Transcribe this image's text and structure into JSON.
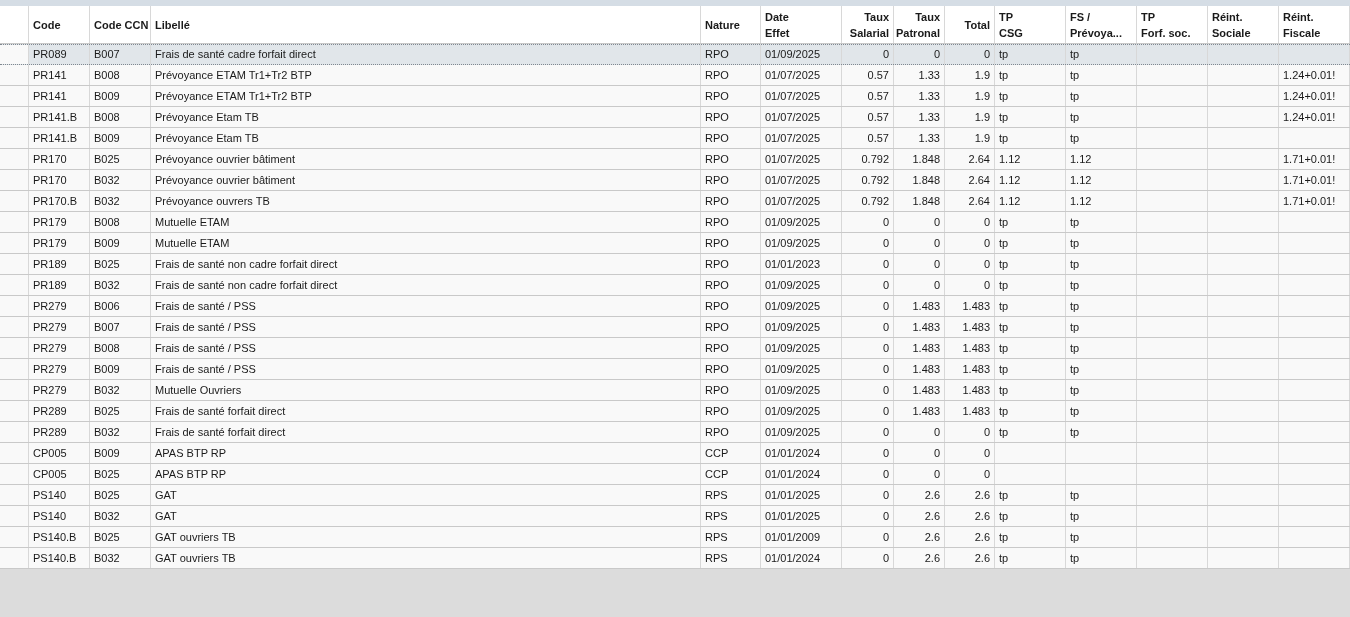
{
  "table": {
    "columns": [
      {
        "lines": [
          "Code"
        ],
        "kind": "text"
      },
      {
        "lines": [
          "Code CCN"
        ],
        "kind": "text"
      },
      {
        "lines": [
          "Libellé"
        ],
        "kind": "text"
      },
      {
        "lines": [
          "Nature"
        ],
        "kind": "text"
      },
      {
        "lines": [
          "Date",
          "Effet"
        ],
        "kind": "text"
      },
      {
        "lines": [
          "Taux",
          "Salarial"
        ],
        "kind": "number"
      },
      {
        "lines": [
          "Taux",
          "Patronal"
        ],
        "kind": "number"
      },
      {
        "lines": [
          "Total"
        ],
        "kind": "number"
      },
      {
        "lines": [
          "TP",
          "CSG"
        ],
        "kind": "text"
      },
      {
        "lines": [
          "FS /",
          "Prévoya..."
        ],
        "kind": "text"
      },
      {
        "lines": [
          "TP",
          "Forf. soc."
        ],
        "kind": "text"
      },
      {
        "lines": [
          "Réint.",
          "Sociale"
        ],
        "kind": "text"
      },
      {
        "lines": [
          "Réint.",
          "Fiscale"
        ],
        "kind": "text"
      }
    ],
    "rows": [
      {
        "selected": true,
        "cells": [
          "PR089",
          "B007",
          "Frais de santé cadre forfait direct",
          "RPO",
          "01/09/2025",
          "0",
          "0",
          "0",
          "tp",
          "tp",
          null,
          null,
          null
        ]
      },
      {
        "selected": false,
        "cells": [
          "PR141",
          "B008",
          "Prévoyance ETAM Tr1+Tr2 BTP",
          "RPO",
          "01/07/2025",
          "0.57",
          "1.33",
          "1.9",
          "tp",
          "tp",
          null,
          null,
          "1.24+0.01!"
        ]
      },
      {
        "selected": false,
        "cells": [
          "PR141",
          "B009",
          "Prévoyance ETAM Tr1+Tr2 BTP",
          "RPO",
          "01/07/2025",
          "0.57",
          "1.33",
          "1.9",
          "tp",
          "tp",
          null,
          null,
          "1.24+0.01!"
        ]
      },
      {
        "selected": false,
        "cells": [
          "PR141.B",
          "B008",
          "Prévoyance Etam TB",
          "RPO",
          "01/07/2025",
          "0.57",
          "1.33",
          "1.9",
          "tp",
          "tp",
          null,
          null,
          "1.24+0.01!"
        ]
      },
      {
        "selected": false,
        "cells": [
          "PR141.B",
          "B009",
          "Prévoyance Etam TB",
          "RPO",
          "01/07/2025",
          "0.57",
          "1.33",
          "1.9",
          "tp",
          "tp",
          null,
          null,
          null
        ]
      },
      {
        "selected": false,
        "cells": [
          "PR170",
          "B025",
          "Prévoyance ouvrier bâtiment",
          "RPO",
          "01/07/2025",
          "0.792",
          "1.848",
          "2.64",
          "1.12",
          "1.12",
          null,
          null,
          "1.71+0.01!"
        ]
      },
      {
        "selected": false,
        "cells": [
          "PR170",
          "B032",
          "Prévoyance ouvrier bâtiment",
          "RPO",
          "01/07/2025",
          "0.792",
          "1.848",
          "2.64",
          "1.12",
          "1.12",
          null,
          null,
          "1.71+0.01!"
        ]
      },
      {
        "selected": false,
        "cells": [
          "PR170.B",
          "B032",
          "Prévoyance ouvrers TB",
          "RPO",
          "01/07/2025",
          "0.792",
          "1.848",
          "2.64",
          "1.12",
          "1.12",
          null,
          null,
          "1.71+0.01!"
        ]
      },
      {
        "selected": false,
        "cells": [
          "PR179",
          "B008",
          "Mutuelle ETAM",
          "RPO",
          "01/09/2025",
          "0",
          "0",
          "0",
          "tp",
          "tp",
          null,
          null,
          null
        ]
      },
      {
        "selected": false,
        "cells": [
          "PR179",
          "B009",
          "Mutuelle ETAM",
          "RPO",
          "01/09/2025",
          "0",
          "0",
          "0",
          "tp",
          "tp",
          null,
          null,
          null
        ]
      },
      {
        "selected": false,
        "cells": [
          "PR189",
          "B025",
          "Frais de santé non cadre forfait direct",
          "RPO",
          "01/01/2023",
          "0",
          "0",
          "0",
          "tp",
          "tp",
          null,
          null,
          null
        ]
      },
      {
        "selected": false,
        "cells": [
          "PR189",
          "B032",
          "Frais de santé non cadre forfait direct",
          "RPO",
          "01/09/2025",
          "0",
          "0",
          "0",
          "tp",
          "tp",
          null,
          null,
          null
        ]
      },
      {
        "selected": false,
        "cells": [
          "PR279",
          "B006",
          "Frais de santé / PSS",
          "RPO",
          "01/09/2025",
          "0",
          "1.483",
          "1.483",
          "tp",
          "tp",
          null,
          null,
          null
        ]
      },
      {
        "selected": false,
        "cells": [
          "PR279",
          "B007",
          "Frais de santé / PSS",
          "RPO",
          "01/09/2025",
          "0",
          "1.483",
          "1.483",
          "tp",
          "tp",
          null,
          null,
          null
        ]
      },
      {
        "selected": false,
        "cells": [
          "PR279",
          "B008",
          "Frais de santé / PSS",
          "RPO",
          "01/09/2025",
          "0",
          "1.483",
          "1.483",
          "tp",
          "tp",
          null,
          null,
          null
        ]
      },
      {
        "selected": false,
        "cells": [
          "PR279",
          "B009",
          "Frais de santé / PSS",
          "RPO",
          "01/09/2025",
          "0",
          "1.483",
          "1.483",
          "tp",
          "tp",
          null,
          null,
          null
        ]
      },
      {
        "selected": false,
        "cells": [
          "PR279",
          "B032",
          "Mutuelle Ouvriers",
          "RPO",
          "01/09/2025",
          "0",
          "1.483",
          "1.483",
          "tp",
          "tp",
          null,
          null,
          null
        ]
      },
      {
        "selected": false,
        "cells": [
          "PR289",
          "B025",
          "Frais de santé forfait direct",
          "RPO",
          "01/09/2025",
          "0",
          "1.483",
          "1.483",
          "tp",
          "tp",
          null,
          null,
          null
        ]
      },
      {
        "selected": false,
        "cells": [
          "PR289",
          "B032",
          "Frais de santé forfait direct",
          "RPO",
          "01/09/2025",
          "0",
          "0",
          "0",
          "tp",
          "tp",
          null,
          null,
          null
        ]
      },
      {
        "selected": false,
        "cells": [
          "CP005",
          "B009",
          "APAS BTP RP",
          "CCP",
          "01/01/2024",
          "0",
          "0",
          "0",
          null,
          null,
          null,
          null,
          null
        ]
      },
      {
        "selected": false,
        "cells": [
          "CP005",
          "B025",
          "APAS BTP RP",
          "CCP",
          "01/01/2024",
          "0",
          "0",
          "0",
          null,
          null,
          null,
          null,
          null
        ]
      },
      {
        "selected": false,
        "cells": [
          "PS140",
          "B025",
          "GAT",
          "RPS",
          "01/01/2025",
          "0",
          "2.6",
          "2.6",
          "tp",
          "tp",
          null,
          null,
          null
        ]
      },
      {
        "selected": false,
        "cells": [
          "PS140",
          "B032",
          "GAT",
          "RPS",
          "01/01/2025",
          "0",
          "2.6",
          "2.6",
          "tp",
          "tp",
          null,
          null,
          null
        ]
      },
      {
        "selected": false,
        "cells": [
          "PS140.B",
          "B025",
          "GAT ouvriers TB",
          "RPS",
          "01/01/2009",
          "0",
          "2.6",
          "2.6",
          "tp",
          "tp",
          null,
          null,
          null
        ]
      },
      {
        "selected": false,
        "cells": [
          "PS140.B",
          "B032",
          "GAT ouvriers TB",
          "RPS",
          "01/01/2024",
          "0",
          "2.6",
          "2.6",
          "tp",
          "tp",
          null,
          null,
          null
        ]
      }
    ]
  }
}
